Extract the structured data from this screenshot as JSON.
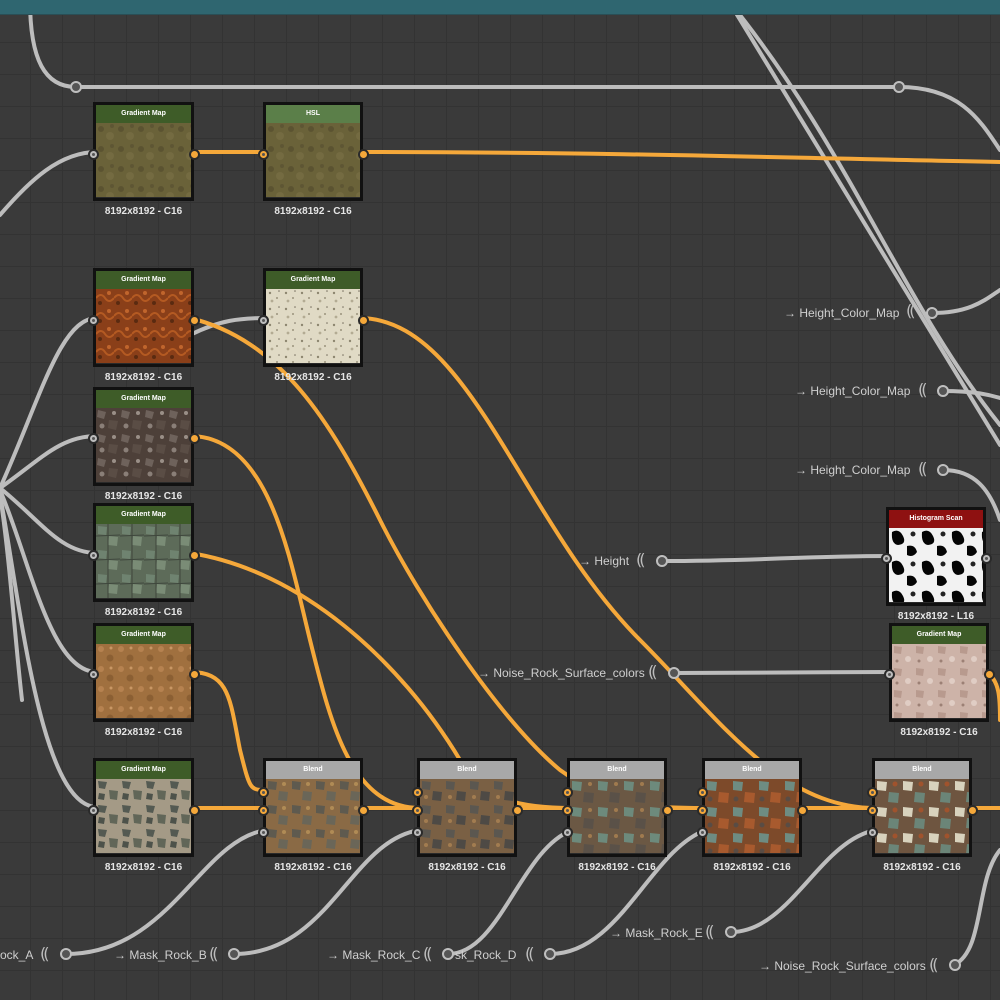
{
  "colors": {
    "canvas_bg": "#3a3a3a",
    "grid_line": "#333333",
    "frame_header": "#2f6670",
    "header_green": "#3e5c28",
    "header_hsl": "#5b7f49",
    "header_blend": "#a8a8a8",
    "header_histogram": "#8e1111",
    "wire_orange": "#f5a83a",
    "wire_gray": "#bdbdbd",
    "label_text": "#cfcfcf"
  },
  "nodes": [
    {
      "id": "gm-top",
      "title": "Gradient Map",
      "res": "8192x8192 - C16",
      "header": "green",
      "thumb": "olive"
    },
    {
      "id": "hsl",
      "title": "HSL",
      "res": "8192x8192 - C16",
      "header": "hsl",
      "thumb": "olive"
    },
    {
      "id": "gm-rust",
      "title": "Gradient Map",
      "res": "8192x8192 - C16",
      "header": "green",
      "thumb": "rust"
    },
    {
      "id": "gm-cream",
      "title": "Gradient Map",
      "res": "8192x8192 - C16",
      "header": "green",
      "thumb": "cream"
    },
    {
      "id": "gm-brownstone",
      "title": "Gradient Map",
      "res": "8192x8192 - C16",
      "header": "green",
      "thumb": "brownstone"
    },
    {
      "id": "gm-greenstone",
      "title": "Gradient Map",
      "res": "8192x8192 - C16",
      "header": "green",
      "thumb": "greenstone"
    },
    {
      "id": "gm-tan",
      "title": "Gradient Map",
      "res": "8192x8192 - C16",
      "header": "green",
      "thumb": "tan"
    },
    {
      "id": "gm-mosaic",
      "title": "Gradient Map",
      "res": "8192x8192 - C16",
      "header": "green",
      "thumb": "mosaic"
    },
    {
      "id": "blend-1",
      "title": "Blend",
      "res": "8192x8192 - C16",
      "header": "blend",
      "thumb": "blend1"
    },
    {
      "id": "blend-2",
      "title": "Blend",
      "res": "8192x8192 - C16",
      "header": "blend",
      "thumb": "blend2"
    },
    {
      "id": "blend-3",
      "title": "Blend",
      "res": "8192x8192 - C16",
      "header": "blend",
      "thumb": "blend3"
    },
    {
      "id": "blend-4",
      "title": "Blend",
      "res": "8192x8192 - C16",
      "header": "blend",
      "thumb": "blend4"
    },
    {
      "id": "blend-5",
      "title": "Blend",
      "res": "8192x8192 - C16",
      "header": "blend",
      "thumb": "blend5"
    },
    {
      "id": "histogram",
      "title": "Histogram Scan",
      "res": "8192x8192 - L16",
      "header": "histogram",
      "thumb": "bw"
    },
    {
      "id": "gm-pink",
      "title": "Gradient Map",
      "res": "8192x8192 - C16",
      "header": "green",
      "thumb": "pink"
    }
  ],
  "inputs": [
    {
      "id": "hcm-1",
      "label": "→ Height_Color_Map"
    },
    {
      "id": "hcm-2",
      "label": "→ Height_Color_Map"
    },
    {
      "id": "hcm-3",
      "label": "→ Height_Color_Map"
    },
    {
      "id": "height",
      "label": "→ Height"
    },
    {
      "id": "noise-1",
      "label": "→ Noise_Rock_Surface_colors"
    },
    {
      "id": "mask-a",
      "label": "ock_A"
    },
    {
      "id": "mask-b",
      "label": "→ Mask_Rock_B"
    },
    {
      "id": "mask-c",
      "label": "→ Mask_Rock_C"
    },
    {
      "id": "mask-d",
      "label": "sk_Rock_D"
    },
    {
      "id": "mask-e",
      "label": "→ Mask_Rock_E"
    },
    {
      "id": "noise-2",
      "label": "→ Noise_Rock_Surface_colors"
    }
  ]
}
